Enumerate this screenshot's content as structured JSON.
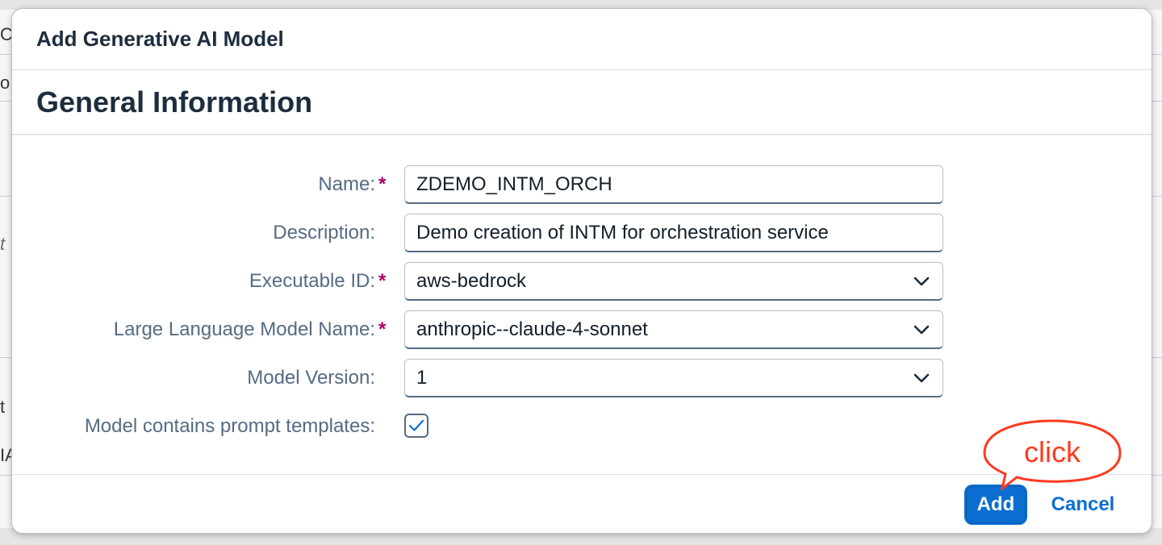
{
  "background": {
    "fragments": [
      "C",
      "o",
      "t",
      "t",
      "IA"
    ]
  },
  "dialog": {
    "title": "Add Generative AI Model",
    "section_title": "General Information",
    "fields": {
      "name": {
        "label": "Name:",
        "value": "ZDEMO_INTM_ORCH",
        "required": true
      },
      "description": {
        "label": "Description:",
        "value": "Demo creation of INTM for orchestration service",
        "required": false
      },
      "executable_id": {
        "label": "Executable ID:",
        "value": "aws-bedrock",
        "required": true,
        "type": "select"
      },
      "llm_name": {
        "label": "Large Language Model Name:",
        "value": "anthropic--claude-4-sonnet",
        "required": true,
        "type": "select"
      },
      "model_version": {
        "label": "Model Version:",
        "value": "1",
        "required": false,
        "type": "select"
      },
      "prompt_templates": {
        "label": "Model contains prompt templates:",
        "checked": true
      }
    },
    "required_marker": "*",
    "footer": {
      "add_label": "Add",
      "cancel_label": "Cancel"
    }
  },
  "annotation": {
    "callout_text": "click"
  },
  "colors": {
    "primary": "#0a6ed1",
    "required": "#aa0066",
    "label": "#556b82",
    "annotation": "#ff3a1f"
  }
}
